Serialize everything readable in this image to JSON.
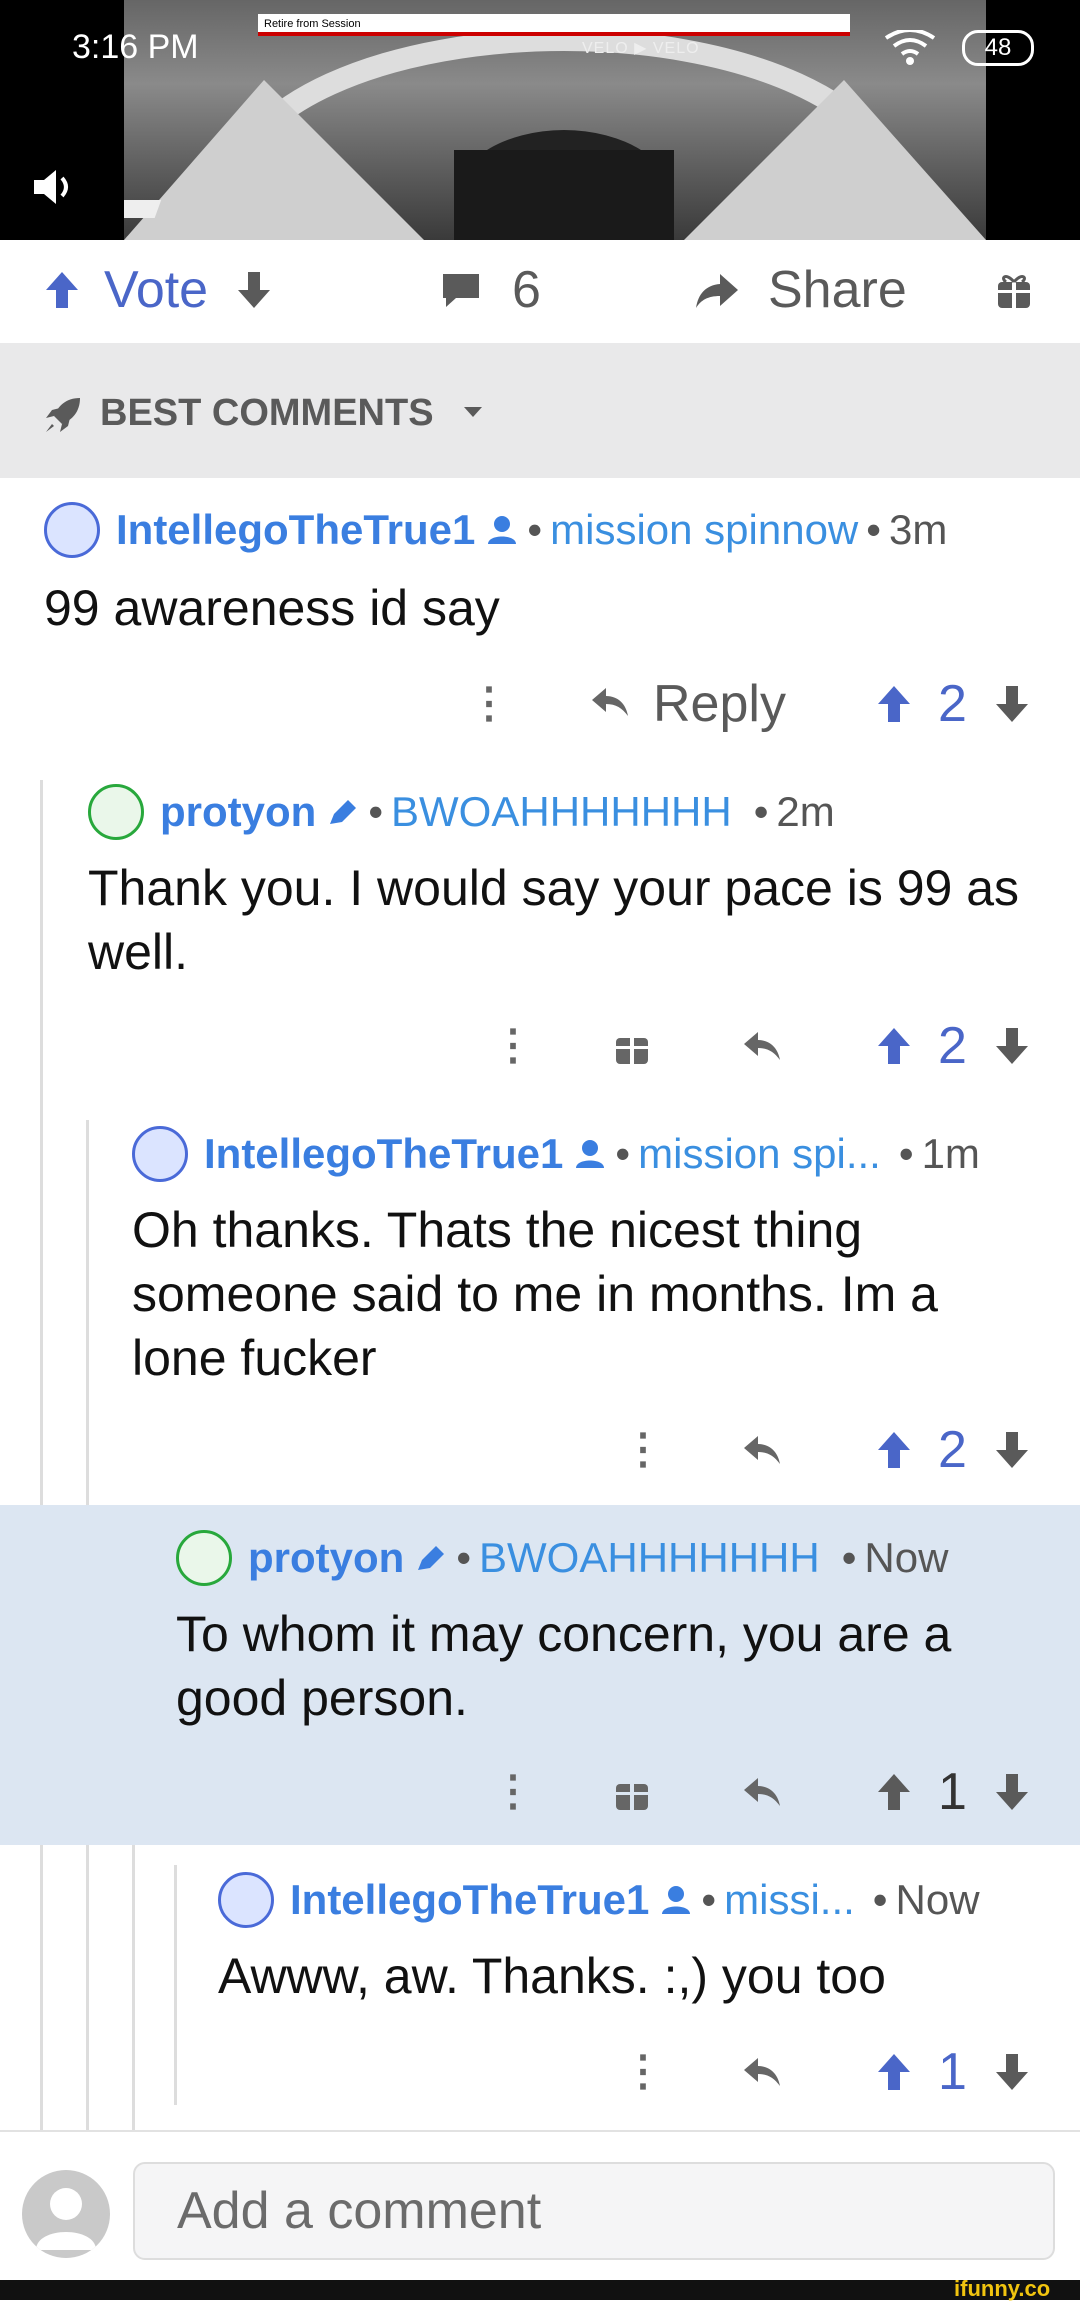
{
  "status_bar": {
    "time": "3:16 PM",
    "battery": "48"
  },
  "video": {
    "banner_text": "Retire from Session",
    "overlay_text": "VELO ▶ VELO"
  },
  "action_bar": {
    "vote_label": "Vote",
    "comment_count": "6",
    "share_label": "Share"
  },
  "best_comments": {
    "label": "BEST COMMENTS"
  },
  "comments": [
    {
      "username": "IntellegoTheTrue1",
      "flair": "mission spinnow",
      "time": "3m",
      "text": "99 awareness id say",
      "reply_label": "Reply",
      "score": "2"
    },
    {
      "username": "protyon",
      "flair": "BWOAHHHHHHH",
      "time": "2m",
      "text": "Thank you. I would say your pace is 99 as well.",
      "score": "2"
    },
    {
      "username": "IntellegoTheTrue1",
      "flair": "mission spi...",
      "time": "1m",
      "text": "Oh thanks. Thats the nicest thing someone said to me in months. Im a lone fucker",
      "score": "2"
    },
    {
      "username": "protyon",
      "flair": "BWOAHHHHHHH",
      "time": "Now",
      "text": "To whom it may concern, you are a good person.",
      "score": "1"
    },
    {
      "username": "IntellegoTheTrue1",
      "flair": "missi...",
      "time": "Now",
      "text": "Awww, aw. Thanks. :,) you too",
      "score": "1"
    }
  ],
  "comment_input": {
    "placeholder": "Add a comment"
  },
  "watermark": "ifunny.co",
  "colors": {
    "accent_blue": "#4a66c8",
    "link_blue": "#3a7ee0",
    "highlight_bg": "#dce6f2",
    "gray": "#5a5a5a"
  }
}
